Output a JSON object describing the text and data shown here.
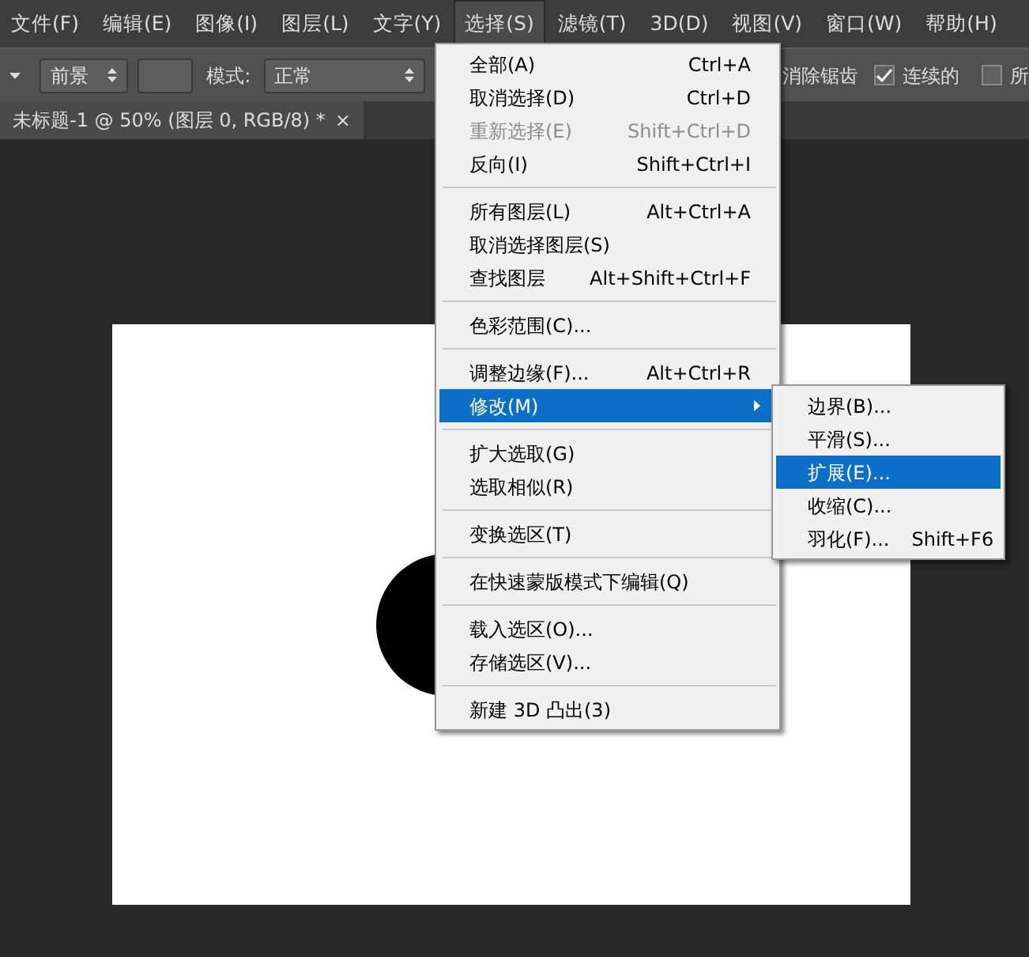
{
  "menubar": [
    {
      "label": "文件(F)",
      "selected": false
    },
    {
      "label": "编辑(E)",
      "selected": false
    },
    {
      "label": "图像(I)",
      "selected": false
    },
    {
      "label": "图层(L)",
      "selected": false
    },
    {
      "label": "文字(Y)",
      "selected": false
    },
    {
      "label": "选择(S)",
      "selected": true
    },
    {
      "label": "滤镜(T)",
      "selected": false
    },
    {
      "label": "3D(D)",
      "selected": false
    },
    {
      "label": "视图(V)",
      "selected": false
    },
    {
      "label": "窗口(W)",
      "selected": false
    },
    {
      "label": "帮助(H)",
      "selected": false
    }
  ],
  "options_bar": {
    "fill_select": "前景",
    "mode_label": "模式:",
    "mode_select": "正常",
    "antialias_label": "消除锯齿",
    "checkboxes": [
      {
        "label": "连续的",
        "checked": true
      },
      {
        "label": "所",
        "checked": false
      }
    ]
  },
  "document_tab": {
    "title": "未标题-1 @ 50% (图层 0, RGB/8) *",
    "close": "×"
  },
  "select_menu": {
    "groups": [
      [
        {
          "label": "全部(A)",
          "shortcut": "Ctrl+A",
          "disabled": false,
          "selected": false,
          "submenu": false
        },
        {
          "label": "取消选择(D)",
          "shortcut": "Ctrl+D",
          "disabled": false,
          "selected": false,
          "submenu": false
        },
        {
          "label": "重新选择(E)",
          "shortcut": "Shift+Ctrl+D",
          "disabled": true,
          "selected": false,
          "submenu": false
        },
        {
          "label": "反向(I)",
          "shortcut": "Shift+Ctrl+I",
          "disabled": false,
          "selected": false,
          "submenu": false
        }
      ],
      [
        {
          "label": "所有图层(L)",
          "shortcut": "Alt+Ctrl+A",
          "disabled": false,
          "selected": false,
          "submenu": false
        },
        {
          "label": "取消选择图层(S)",
          "disabled": false,
          "selected": false,
          "submenu": false
        },
        {
          "label": "查找图层",
          "shortcut": "Alt+Shift+Ctrl+F",
          "disabled": false,
          "selected": false,
          "submenu": false
        }
      ],
      [
        {
          "label": "色彩范围(C)...",
          "disabled": false,
          "selected": false,
          "submenu": false
        }
      ],
      [
        {
          "label": "调整边缘(F)...",
          "shortcut": "Alt+Ctrl+R",
          "disabled": false,
          "selected": false,
          "submenu": false
        },
        {
          "label": "修改(M)",
          "disabled": false,
          "selected": true,
          "submenu": true
        }
      ],
      [
        {
          "label": "扩大选取(G)",
          "disabled": false,
          "selected": false,
          "submenu": false
        },
        {
          "label": "选取相似(R)",
          "disabled": false,
          "selected": false,
          "submenu": false
        }
      ],
      [
        {
          "label": "变换选区(T)",
          "disabled": false,
          "selected": false,
          "submenu": false
        }
      ],
      [
        {
          "label": "在快速蒙版模式下编辑(Q)",
          "disabled": false,
          "selected": false,
          "submenu": false
        }
      ],
      [
        {
          "label": "载入选区(O)...",
          "disabled": false,
          "selected": false,
          "submenu": false
        },
        {
          "label": "存储选区(V)...",
          "disabled": false,
          "selected": false,
          "submenu": false
        }
      ],
      [
        {
          "label": "新建 3D 凸出(3)",
          "disabled": false,
          "selected": false,
          "submenu": false
        }
      ]
    ]
  },
  "modify_submenu": {
    "items": [
      {
        "label": "边界(B)...",
        "selected": false
      },
      {
        "label": "平滑(S)...",
        "selected": false
      },
      {
        "label": "扩展(E)...",
        "selected": true
      },
      {
        "label": "收缩(C)...",
        "selected": false
      },
      {
        "label": "羽化(F)...",
        "shortcut": "Shift+F6",
        "selected": false
      }
    ]
  }
}
